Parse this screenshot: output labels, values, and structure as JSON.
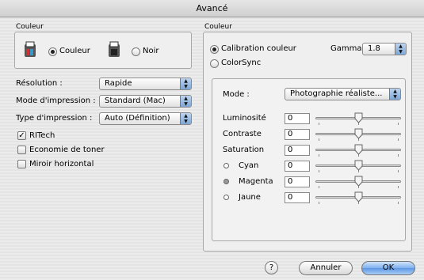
{
  "window": {
    "title": "Avancé"
  },
  "colour_group": {
    "label": "Couleur",
    "option_color": "Couleur",
    "option_black": "Noir",
    "selected": "Couleur"
  },
  "settings": {
    "resolution_label": "Résolution :",
    "resolution_value": "Rapide",
    "print_mode_label": "Mode d'impression :",
    "print_mode_value": "Standard (Mac)",
    "print_type_label": "Type d'impression :",
    "print_type_value": "Auto (Définition)"
  },
  "checkboxes": [
    {
      "label": "RITech",
      "checked": true
    },
    {
      "label": "Economie de toner",
      "checked": false
    },
    {
      "label": "Miroir horizontal",
      "checked": false
    }
  ],
  "right_group": {
    "label": "Couleur",
    "calibration_label": "Calibration couleur",
    "colorsync_label": "ColorSync",
    "gamma_label": "Gamma",
    "gamma_value": "1.8"
  },
  "adjust": {
    "mode_label": "Mode :",
    "mode_value": "Photographie réaliste...",
    "rows": [
      {
        "label": "Luminosité",
        "value": "0",
        "level": 0.5,
        "dot": ""
      },
      {
        "label": "Contraste",
        "value": "0",
        "level": 0.5,
        "dot": ""
      },
      {
        "label": "Saturation",
        "value": "0",
        "level": 0.5,
        "dot": ""
      },
      {
        "label": "Cyan",
        "value": "0",
        "level": 0.5,
        "dot": "#ffffff"
      },
      {
        "label": "Magenta",
        "value": "0",
        "level": 0.5,
        "dot": "#9a9a9a"
      },
      {
        "label": "Jaune",
        "value": "0",
        "level": 0.5,
        "dot": "#ffffff"
      }
    ]
  },
  "footer": {
    "help": "?",
    "cancel": "Annuler",
    "ok": "OK"
  }
}
